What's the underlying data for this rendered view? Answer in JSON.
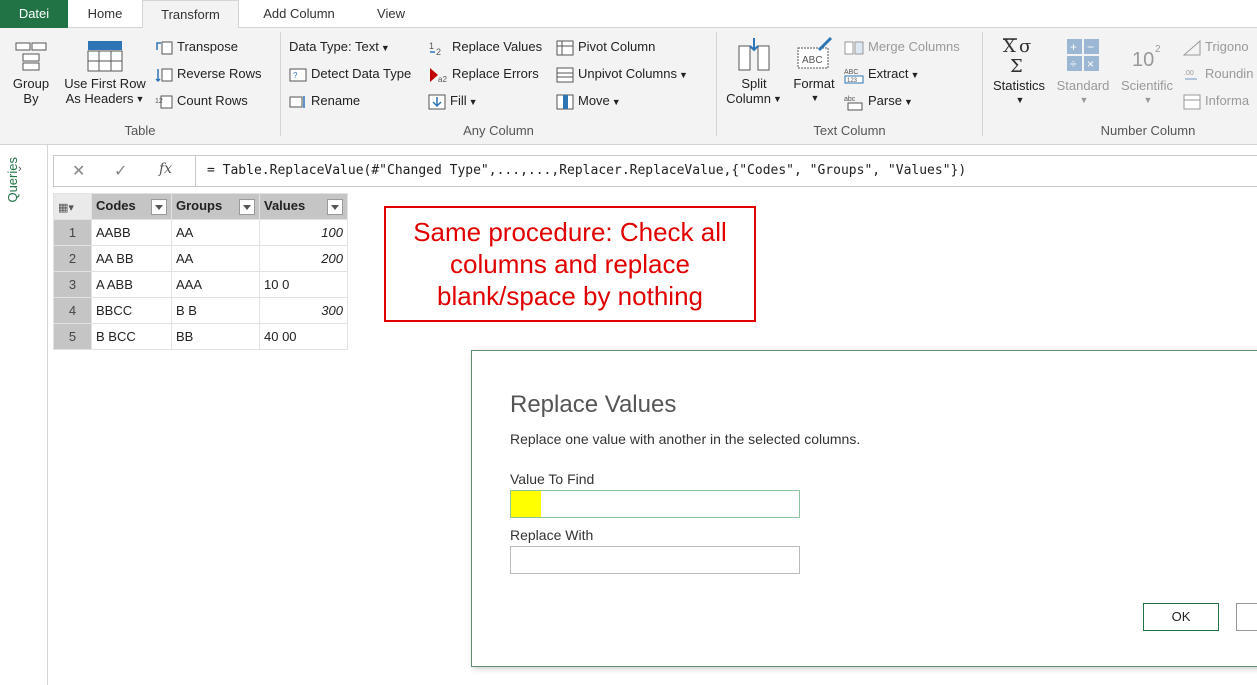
{
  "tabs": {
    "file": "Datei",
    "home": "Home",
    "transform": "Transform",
    "add_column": "Add Column",
    "view": "View"
  },
  "ribbon": {
    "table_group": {
      "label": "Table",
      "group_by": "Group\nBy",
      "group_by_l1": "Group",
      "group_by_l2": "By",
      "use_first_row_l1": "Use First Row",
      "use_first_row_l2": "As Headers",
      "transpose": "Transpose",
      "reverse_rows": "Reverse Rows",
      "count_rows": "Count Rows"
    },
    "any_column_group": {
      "label": "Any Column",
      "data_type": "Data Type: Text",
      "detect_data_type": "Detect Data Type",
      "rename": "Rename",
      "replace_values": "Replace Values",
      "replace_errors": "Replace Errors",
      "fill": "Fill",
      "pivot_column": "Pivot Column",
      "unpivot_columns": "Unpivot Columns",
      "move": "Move"
    },
    "text_column_group": {
      "label": "Text Column",
      "split_column_l1": "Split",
      "split_column_l2": "Column",
      "format": "Format",
      "merge_columns": "Merge Columns",
      "extract": "Extract",
      "parse": "Parse"
    },
    "number_column_group": {
      "label": "Number Column",
      "statistics": "Statistics",
      "standard": "Standard",
      "scientific": "Scientific",
      "trigonometry": "Trigono",
      "rounding": "Roundin",
      "information": "Informa"
    }
  },
  "queries_pane": {
    "label": "Queries"
  },
  "formula_bar": {
    "fx": "fx",
    "formula": "= Table.ReplaceValue(#\"Changed Type\",...,...,Replacer.ReplaceValue,{\"Codes\", \"Groups\", \"Values\"})"
  },
  "grid": {
    "columns": [
      "Codes",
      "Groups",
      "Values"
    ],
    "rows": [
      {
        "n": "1",
        "codes": "AABB",
        "groups": "AA",
        "values": "100"
      },
      {
        "n": "2",
        "codes": "AA BB",
        "groups": "AA",
        "values": "200"
      },
      {
        "n": "3",
        "codes": "A ABB",
        "groups": "AAA",
        "values": "10 0"
      },
      {
        "n": "4",
        "codes": "BBCC",
        "groups": "B B",
        "values": "300"
      },
      {
        "n": "5",
        "codes": "B BCC",
        "groups": "BB",
        "values": "40 00"
      }
    ]
  },
  "annotation": {
    "text_l1": "Same procedure: Check all",
    "text_l2": "columns and replace",
    "text_l3": "blank/space by nothing"
  },
  "dialog": {
    "title": "Replace Values",
    "description": "Replace one value with another in the selected columns.",
    "value_to_find_label": "Value To Find",
    "value_to_find": "",
    "replace_with_label": "Replace With",
    "replace_with": "",
    "ok": "OK"
  },
  "colors": {
    "accent": "#217346",
    "annotation_red": "#e00000",
    "highlight_yellow": "#ffff00"
  }
}
